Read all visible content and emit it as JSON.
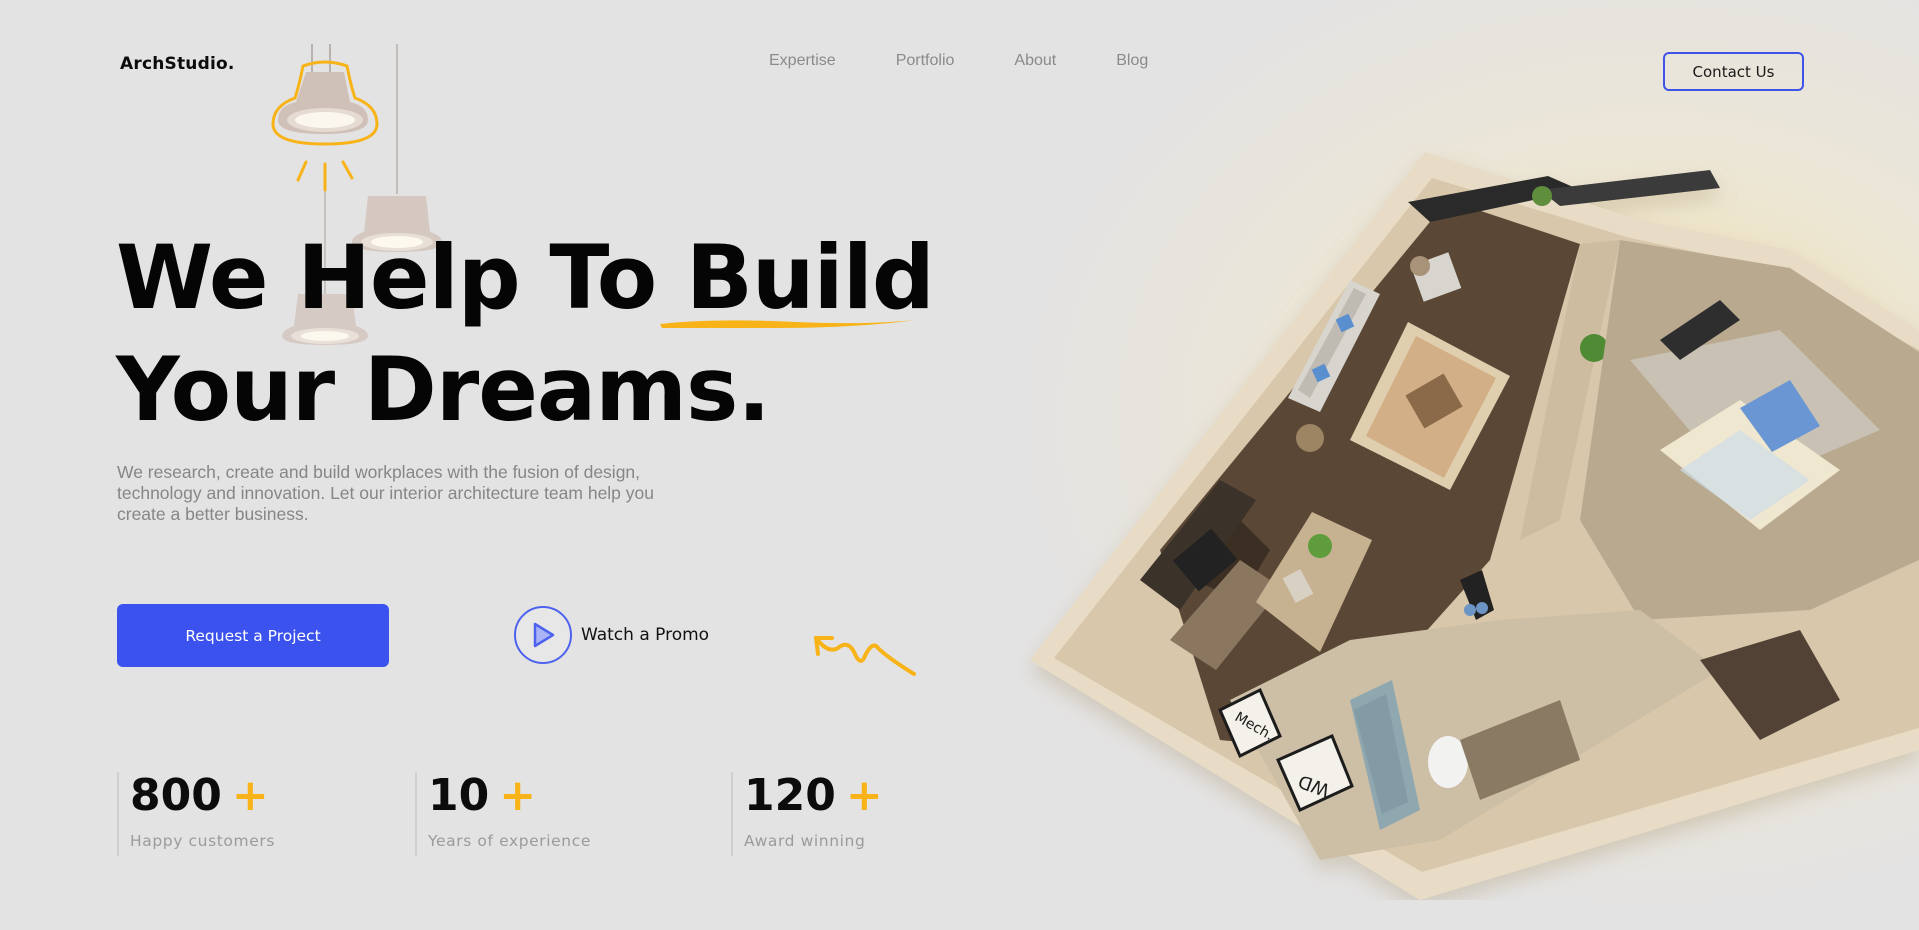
{
  "header": {
    "logo": "ArchStudio.",
    "nav": [
      "Expertise",
      "Portfolio",
      "About",
      "Blog"
    ],
    "contact_label": "Contact Us"
  },
  "hero": {
    "headline_part1": "We Help To ",
    "headline_highlight": "Build",
    "headline_line2": "Your Dreams.",
    "description": "We research, create and build workplaces with the fusion of design, technology and innovation. Let our interior architecture team help you create a better business.",
    "cta_label": "Request a Project",
    "promo_label": "Watch a Promo"
  },
  "stats": [
    {
      "value": "800",
      "suffix": "+",
      "label": "Happy customers"
    },
    {
      "value": "10",
      "suffix": "+",
      "label": "Years of experience"
    },
    {
      "value": "120",
      "suffix": "+",
      "label": "Award winning"
    }
  ],
  "floorplan": {
    "sign_mech": "Mech.",
    "sign_wd": "WD"
  },
  "colors": {
    "accent_blue": "#3b52ee",
    "accent_yellow": "#f7b318",
    "text_dark": "#050505",
    "text_muted": "#868686"
  },
  "icons": [
    "lamp-icon",
    "play-icon",
    "squiggle-arrow-icon",
    "underline-stroke"
  ]
}
